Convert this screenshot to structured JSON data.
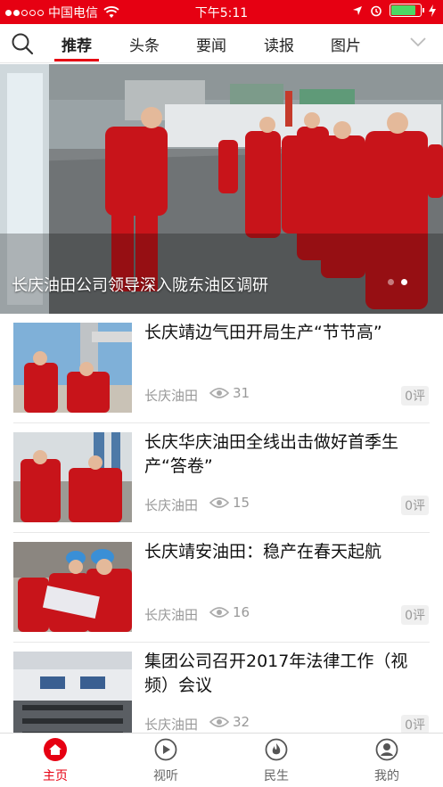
{
  "status_bar": {
    "carrier": "中国电信",
    "time": "下午5:11",
    "battery_level": 0.85
  },
  "tabs": {
    "items": [
      "推荐",
      "头条",
      "要闻",
      "读报",
      "图片"
    ],
    "active": "推荐"
  },
  "banner": {
    "caption": "长庆油田公司领导深入陇东油区调研",
    "page_count": 2,
    "active_page": 1
  },
  "news": [
    {
      "title": "长庆靖边气田开局生产“节节高”",
      "source": "长庆油田",
      "views": "31",
      "comments": "0评"
    },
    {
      "title": "长庆华庆油田全线出击做好首季生产“答卷”",
      "source": "长庆油田",
      "views": "15",
      "comments": "0评"
    },
    {
      "title": "长庆靖安油田：稳产在春天起航",
      "source": "长庆油田",
      "views": "16",
      "comments": "0评"
    },
    {
      "title": "集团公司召开2017年法律工作（视频）会议",
      "source": "长庆油田",
      "views": "32",
      "comments": "0评"
    }
  ],
  "bottom_nav": {
    "items": [
      {
        "label": "主页",
        "icon": "home-icon"
      },
      {
        "label": "视听",
        "icon": "play-icon"
      },
      {
        "label": "民生",
        "icon": "flame-icon"
      },
      {
        "label": "我的",
        "icon": "user-icon"
      }
    ],
    "active": "主页"
  },
  "colors": {
    "brand_red": "#e60012",
    "text_dark": "#111111",
    "text_muted": "#999999"
  }
}
